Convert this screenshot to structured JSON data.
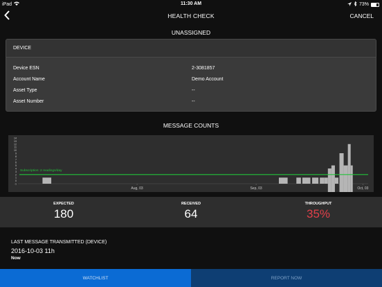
{
  "status_bar": {
    "device": "iPad",
    "time": "11:30 AM",
    "battery": "73%"
  },
  "nav": {
    "back_glyph": "‹",
    "title": "HEALTH CHECK",
    "cancel": "CANCEL"
  },
  "account_title": "UNASSIGNED",
  "device": {
    "header": "DEVICE",
    "rows": [
      {
        "key": "Device ESN",
        "value": "2-3081857"
      },
      {
        "key": "Account Name",
        "value": "Demo Account"
      },
      {
        "key": "Asset Type",
        "value": "--"
      },
      {
        "key": "Asset Number",
        "value": "--"
      }
    ]
  },
  "message_counts": {
    "title": "MESSAGE COUNTS"
  },
  "chart_data": {
    "type": "bar",
    "x_tick_labels": [
      "Aug, 03",
      "Sep, 03",
      "Oct, 03"
    ],
    "y_ticks": [
      -1,
      0,
      1,
      2,
      3,
      4,
      5,
      6,
      7,
      8,
      9,
      10,
      11,
      12,
      13,
      14
    ],
    "ylim": [
      -1,
      14
    ],
    "subscription_label": "Subscription: 2 readings/day",
    "subscription_value": 2,
    "line_color": "#22c33a",
    "bar_color": "#b5b5b5",
    "bars": [
      {
        "start": 0.07,
        "end": 0.095,
        "value": 1
      },
      {
        "start": 0.745,
        "end": 0.77,
        "value": 1
      },
      {
        "start": 0.795,
        "end": 0.808,
        "value": 1
      },
      {
        "start": 0.812,
        "end": 0.835,
        "value": 1
      },
      {
        "start": 0.84,
        "end": 0.858,
        "value": 1
      },
      {
        "start": 0.862,
        "end": 0.874,
        "value": 1
      },
      {
        "start": 0.874,
        "end": 0.885,
        "value": 1
      },
      {
        "start": 0.885,
        "end": 0.895,
        "value": 4
      },
      {
        "start": 0.895,
        "end": 0.905,
        "value": 5
      },
      {
        "start": 0.905,
        "end": 0.915,
        "value": 1
      },
      {
        "start": 0.918,
        "end": 0.93,
        "value": 9
      },
      {
        "start": 0.93,
        "end": 0.942,
        "value": 5
      },
      {
        "start": 0.942,
        "end": 0.95,
        "value": 12
      },
      {
        "start": 0.95,
        "end": 0.956,
        "value": 5
      }
    ]
  },
  "stats": [
    {
      "label": "EXPECTED",
      "value": "180",
      "color": "#ffffff"
    },
    {
      "label": "RECEIVED",
      "value": "64",
      "color": "#ffffff"
    },
    {
      "label": "THROUGHPUT",
      "value": "35%",
      "color": "#e0404a"
    }
  ],
  "last_message": {
    "label": "LAST MESSAGE TRANSMITTED (DEVICE)",
    "date": "2016-10-03 11h",
    "relative": "Now"
  },
  "tabs": {
    "watchlist": "WATCHLIST",
    "report_now": "REPORT NOW"
  }
}
